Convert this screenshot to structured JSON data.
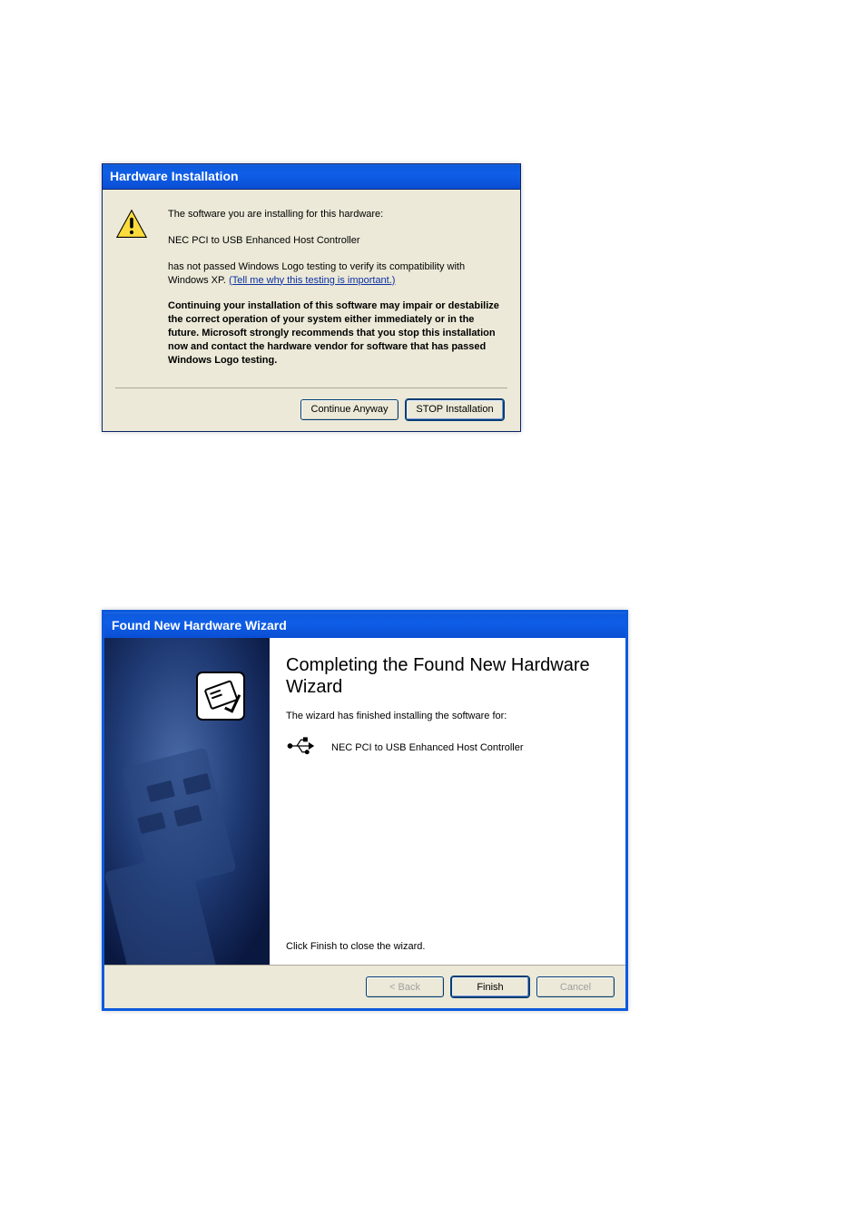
{
  "dialog1": {
    "title": "Hardware Installation",
    "line_intro": "The software you are installing for this hardware:",
    "device": "NEC PCI to USB Enhanced Host Controller",
    "line_notpassed": "has not passed Windows Logo testing to verify its compatibility with Windows XP. ",
    "link_text": "(Tell me why this testing is important.)",
    "warning": "Continuing your installation of this software may impair or destabilize the correct operation of your system either immediately or in the future. Microsoft strongly recommends that you stop this installation now and contact the hardware vendor for software that has passed Windows Logo testing.",
    "btn_continue": "Continue Anyway",
    "btn_stop": "STOP Installation"
  },
  "dialog2": {
    "title": "Found New Hardware Wizard",
    "heading": "Completing the Found New Hardware Wizard",
    "subtext": "The wizard has finished installing the software for:",
    "device": "NEC PCI to USB Enhanced Host Controller",
    "footer": "Click Finish to close the wizard.",
    "btn_back": "< Back",
    "btn_finish": "Finish",
    "btn_cancel": "Cancel"
  }
}
